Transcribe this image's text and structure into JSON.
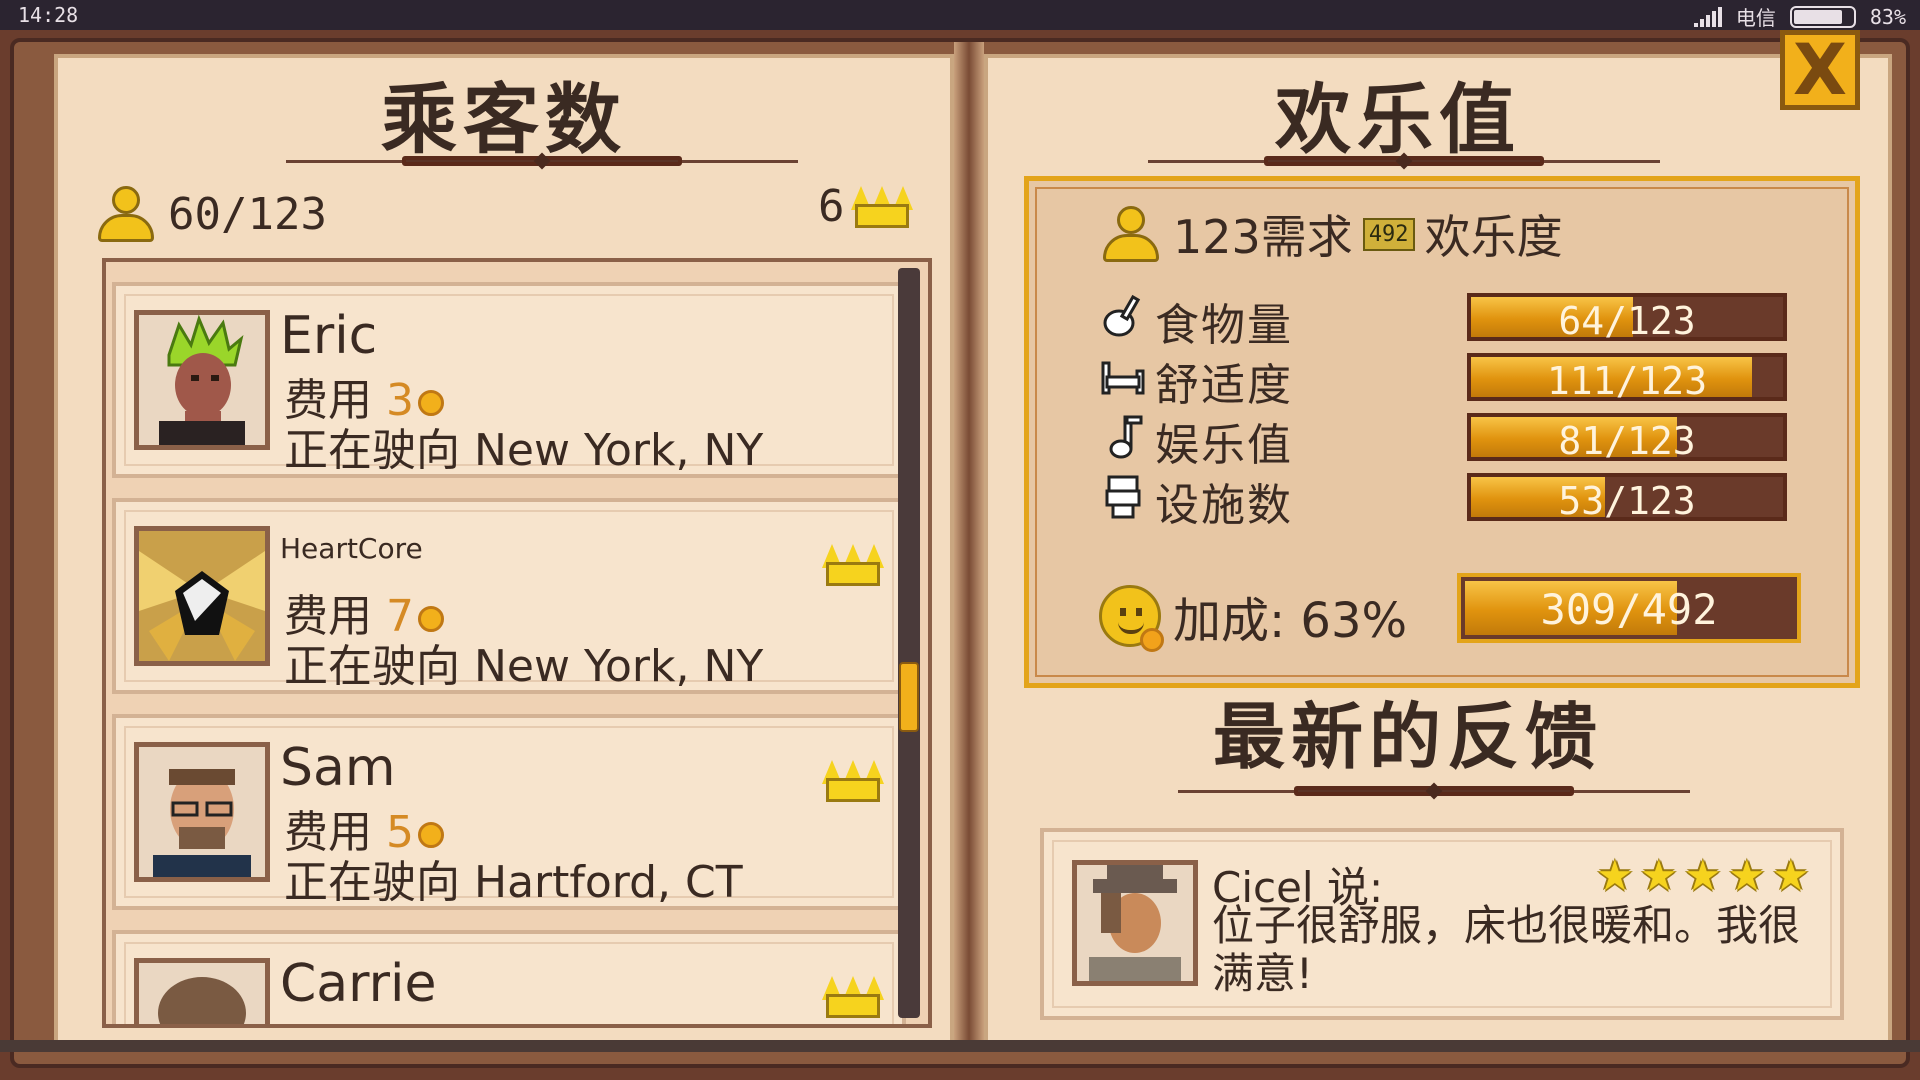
{
  "status_bar": {
    "time": "14:28",
    "carrier": "电信",
    "battery": "83%",
    "battery_level": 0.83
  },
  "left_page": {
    "title": "乘客数",
    "passenger_count": "60/123",
    "vip_count": "6",
    "passengers": [
      {
        "name": "Eric",
        "fee_label": "费用",
        "fee": "3",
        "dest": "正在驶向 New York, NY",
        "vip": false,
        "portrait": "punk-green-hair"
      },
      {
        "name": "HeartCore",
        "fee_label": "费用",
        "fee": "7",
        "dest": "正在驶向 New York, NY",
        "vip": true,
        "portrait": "golden-wings-emblem"
      },
      {
        "name": "Sam",
        "fee_label": "费用",
        "fee": "5",
        "dest": "正在驶向 Hartford, CT",
        "vip": true,
        "portrait": "bearded-glasses"
      },
      {
        "name": "Carrie",
        "fee_label": "",
        "fee": "",
        "dest": "",
        "vip": true,
        "portrait": "brown-hair"
      }
    ],
    "scroll_position": 0.58
  },
  "right_page": {
    "title": "欢乐值",
    "demand_value": "123需求",
    "demand_badge": "492",
    "demand_suffix": "欢乐度",
    "stats": [
      {
        "icon": "drumstick-icon",
        "label": "食物量",
        "value": "64/123",
        "fraction": 0.52
      },
      {
        "icon": "bed-icon",
        "label": "舒适度",
        "value": "111/123",
        "fraction": 0.9
      },
      {
        "icon": "music-note-icon",
        "label": "娱乐值",
        "value": "81/123",
        "fraction": 0.66
      },
      {
        "icon": "toilet-icon",
        "label": "设施数",
        "value": "53/123",
        "fraction": 0.43
      }
    ],
    "bonus_label": "加成: 63%",
    "bonus_value": "309/492",
    "bonus_fraction": 0.63,
    "feedback_title": "最新的反馈",
    "feedback": {
      "speaker": "Cicel 说:",
      "message": "位子很舒服，床也很暖和。我很满意!",
      "stars": 5
    }
  },
  "close_label": "X",
  "colors": {
    "accent": "#f2b01b",
    "page": "#f3dcc0",
    "frame": "#8a5a3f"
  }
}
